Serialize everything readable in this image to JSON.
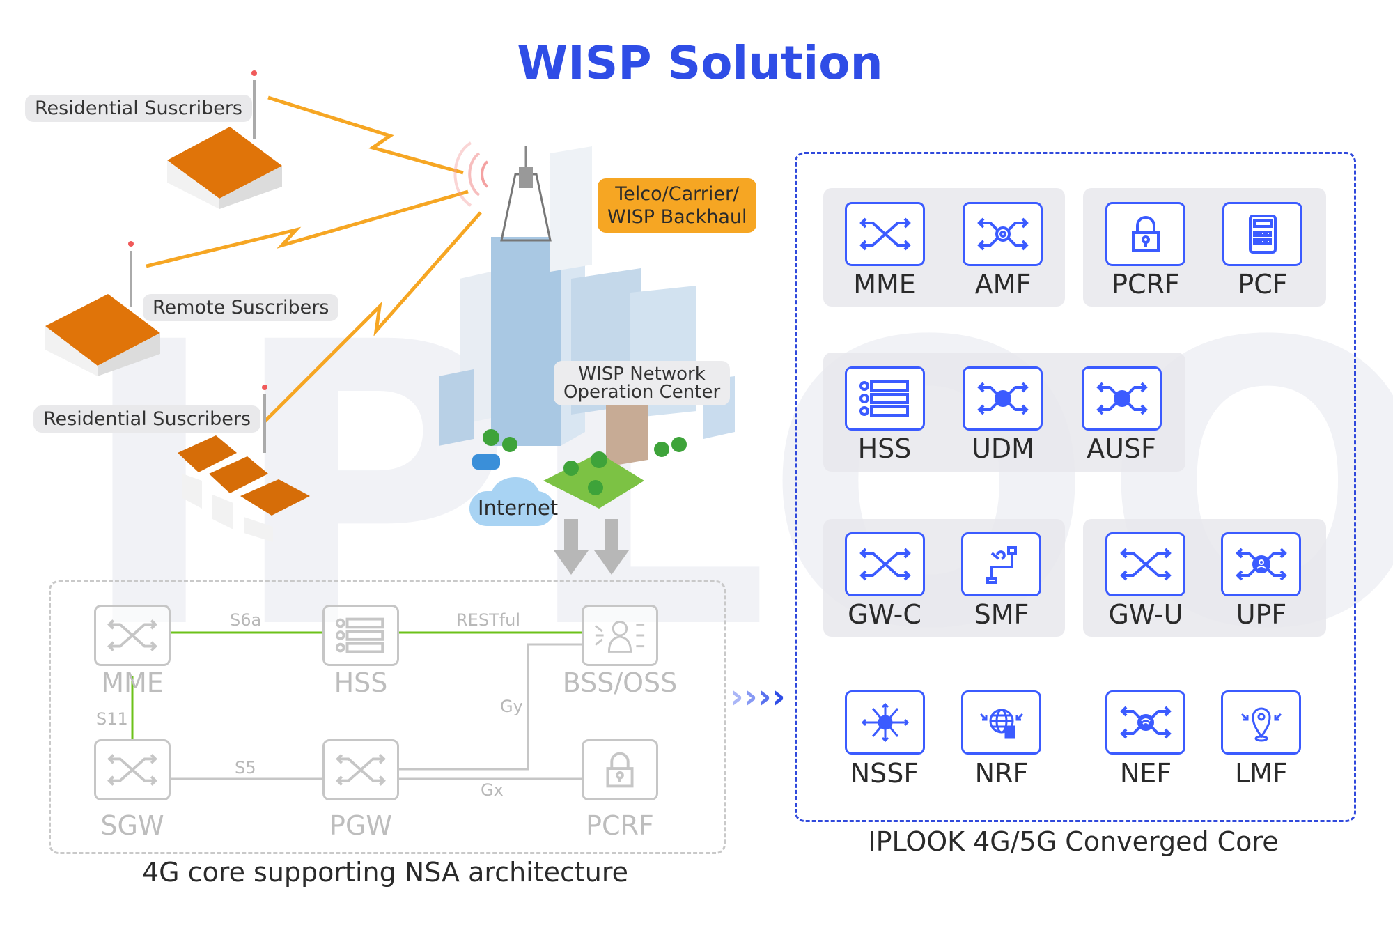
{
  "title": "WISP Solution",
  "watermark": "IPLOOK",
  "colors": {
    "title_blue": "#2f4de6",
    "core_blue": "#3b5bff",
    "lightning_orange": "#f6a623",
    "active_link_green": "#6cc21a",
    "inactive_gray": "#c6c6c6"
  },
  "subscribers": [
    {
      "label": "Residential Suscribers",
      "icon": "house-icon"
    },
    {
      "label": "Remote Suscribers",
      "icon": "house-icon"
    },
    {
      "label": "Residential Suscribers",
      "icon": "row-houses-icon"
    }
  ],
  "city": {
    "backhaul_label_line1": "Telco/Carrier/",
    "backhaul_label_line2": "WISP Backhaul",
    "noc_label_line1": "WISP Network",
    "noc_label_line2": "Operation Center",
    "internet_label": "Internet"
  },
  "core_4g": {
    "caption": "4G core supporting NSA architecture",
    "nodes": [
      {
        "label": "MME",
        "icon": "switch-icon"
      },
      {
        "label": "HSS",
        "icon": "server-list-icon"
      },
      {
        "label": "BSS/OSS",
        "icon": "user-exchange-icon"
      },
      {
        "label": "SGW",
        "icon": "switch-icon"
      },
      {
        "label": "PGW",
        "icon": "switch-icon"
      },
      {
        "label": "PCRF",
        "icon": "lock-icon"
      }
    ],
    "interfaces": [
      {
        "label": "S6a",
        "from": "MME",
        "to": "HSS",
        "active": true
      },
      {
        "label": "RESTful",
        "from": "HSS",
        "to": "BSS/OSS",
        "active": true
      },
      {
        "label": "S11",
        "from": "MME",
        "to": "SGW",
        "active": true
      },
      {
        "label": "S5",
        "from": "SGW",
        "to": "PGW",
        "active": false
      },
      {
        "label": "Gy",
        "from": "PGW",
        "to": "BSS/OSS",
        "active": false
      },
      {
        "label": "Gx",
        "from": "PGW",
        "to": "PCRF",
        "active": false
      }
    ]
  },
  "converged_core": {
    "caption": "IPLOOK 4G/5G Converged Core",
    "functions": [
      {
        "label": "MME",
        "icon": "switch-icon"
      },
      {
        "label": "AMF",
        "icon": "gear-switch-icon"
      },
      {
        "label": "PCRF",
        "icon": "lock-icon"
      },
      {
        "label": "PCF",
        "icon": "calculator-icon"
      },
      {
        "label": "HSS",
        "icon": "server-list-icon"
      },
      {
        "label": "UDM",
        "icon": "database-switch-icon"
      },
      {
        "label": "AUSF",
        "icon": "database-switch-icon"
      },
      {
        "label": "GW-C",
        "icon": "switch-icon"
      },
      {
        "label": "SMF",
        "icon": "wrench-pipe-icon"
      },
      {
        "label": "GW-U",
        "icon": "switch-icon"
      },
      {
        "label": "UPF",
        "icon": "user-switch-icon"
      },
      {
        "label": "NSSF",
        "icon": "globe-arrows-icon"
      },
      {
        "label": "NRF",
        "icon": "globe-document-icon"
      },
      {
        "label": "NEF",
        "icon": "wifi-switch-icon"
      },
      {
        "label": "LMF",
        "icon": "location-pin-icon"
      }
    ]
  }
}
